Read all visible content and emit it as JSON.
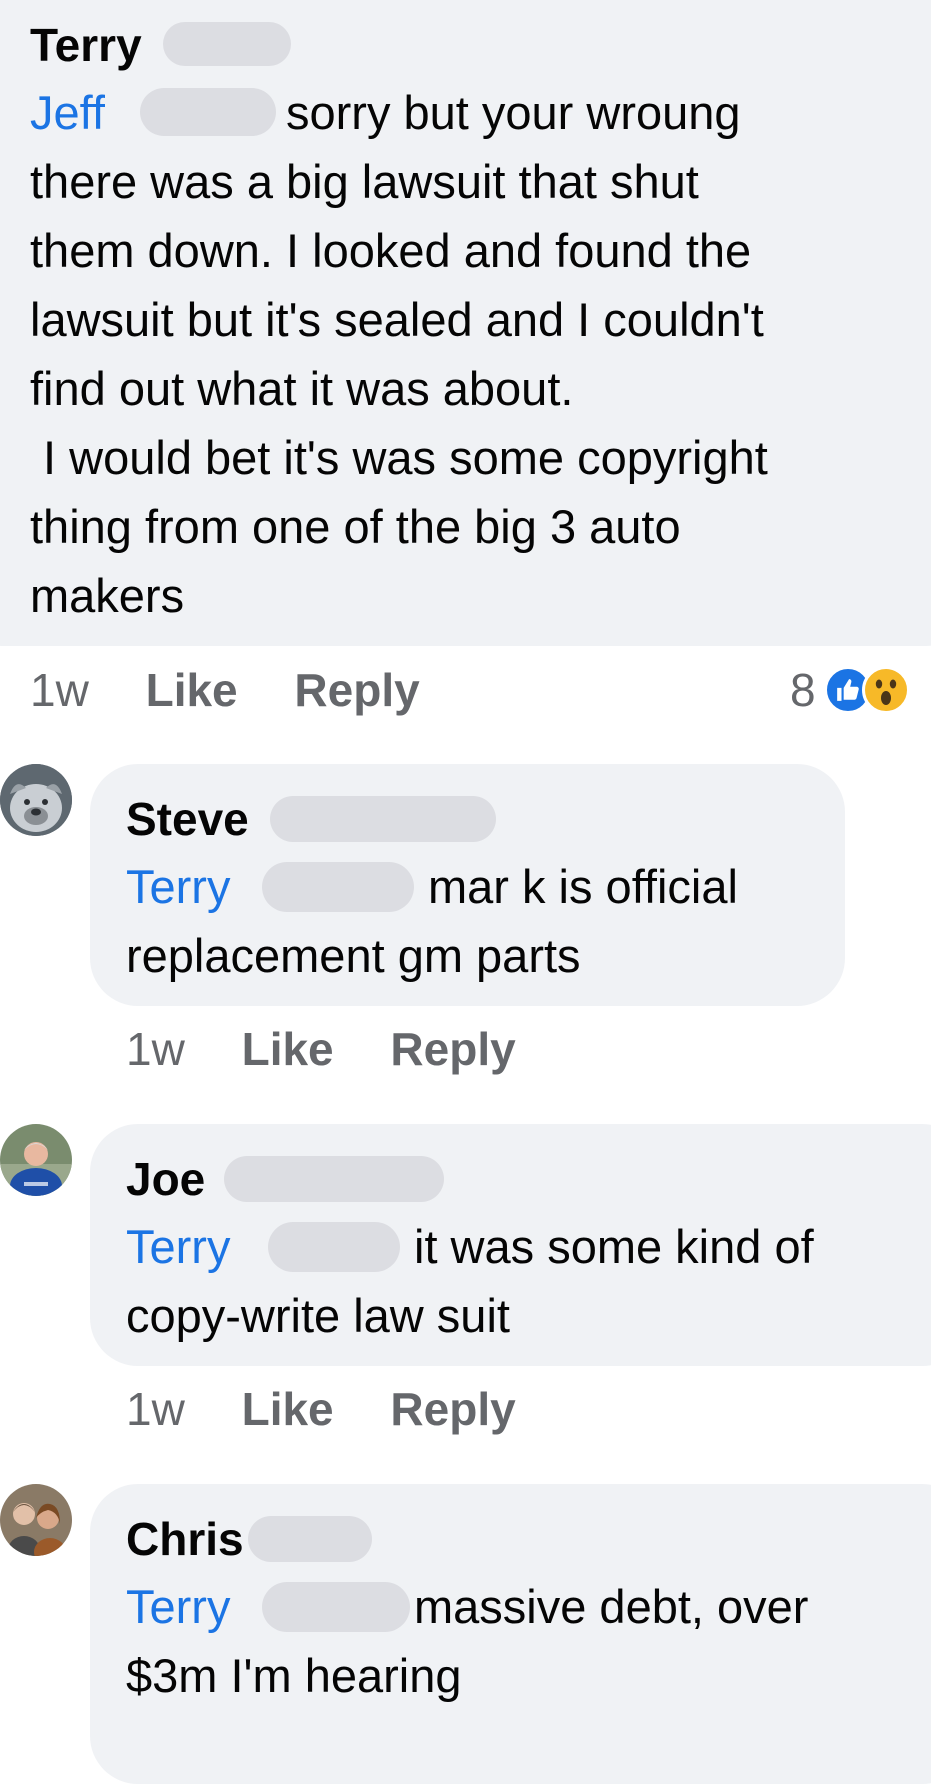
{
  "comments": [
    {
      "author": "Terry",
      "mention": "Jeff",
      "lines": [
        "sorry but your wroung",
        "there was a big lawsuit that shut",
        "them down. I looked and found the",
        "lawsuit but it's sealed and I couldn't",
        "find out what it was about.",
        " I would bet it's was some copyright",
        "thing from one of the big 3 auto",
        "makers"
      ],
      "time": "1w",
      "like_label": "Like",
      "reply_label": "Reply",
      "reaction_count": "8",
      "reaction_icons": [
        "like-icon",
        "wow-icon"
      ]
    },
    {
      "author": "Steve",
      "mention": "Terry",
      "lines": [
        "mar k is official",
        "replacement gm parts"
      ],
      "time": "1w",
      "like_label": "Like",
      "reply_label": "Reply",
      "avatar_icon": "dog-avatar"
    },
    {
      "author": "Joe",
      "mention": "Terry",
      "lines": [
        "it was some kind of",
        "copy-write law suit"
      ],
      "time": "1w",
      "like_label": "Like",
      "reply_label": "Reply",
      "avatar_icon": "man-avatar"
    },
    {
      "author": "Chris",
      "mention": "Terry",
      "lines": [
        "massive debt, over",
        "$3m I'm hearing"
      ],
      "avatar_icon": "couple-avatar"
    }
  ],
  "colors": {
    "bubble": "#f0f2f5",
    "mention": "#1b74e4",
    "meta": "#65676b",
    "like_reaction": "#1b74e4",
    "wow_reaction": "#f7b928"
  }
}
